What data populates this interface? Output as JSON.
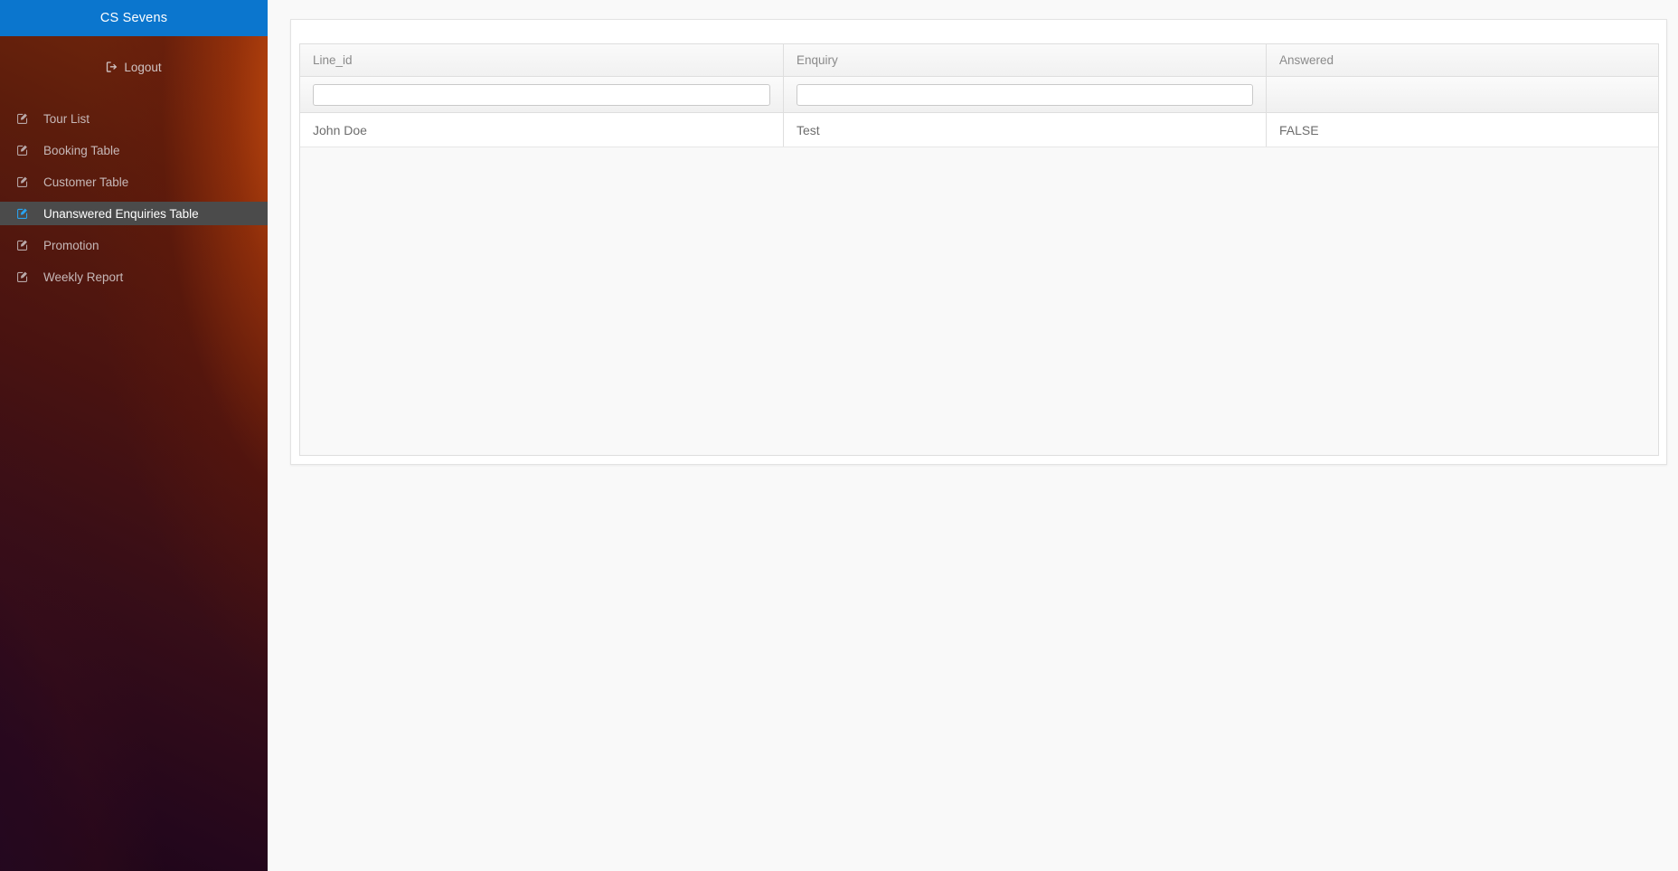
{
  "sidebar": {
    "brand": "CS Sevens",
    "logout": {
      "label": "Logout",
      "icon": "sign-out-icon"
    },
    "items": [
      {
        "label": "Tour List",
        "icon": "edit-square-icon",
        "active": false
      },
      {
        "label": "Booking Table",
        "icon": "edit-square-icon",
        "active": false
      },
      {
        "label": "Customer Table",
        "icon": "edit-square-icon",
        "active": false
      },
      {
        "label": "Unanswered Enquiries Table",
        "icon": "edit-square-icon",
        "active": true
      },
      {
        "label": "Promotion",
        "icon": "edit-square-icon",
        "active": false
      },
      {
        "label": "Weekly Report",
        "icon": "edit-square-icon",
        "active": false
      }
    ]
  },
  "table": {
    "columns": [
      {
        "header": "Line_id",
        "has_filter": true,
        "filter_value": "",
        "filter_placeholder": ""
      },
      {
        "header": "Enquiry",
        "has_filter": true,
        "filter_value": "",
        "filter_placeholder": ""
      },
      {
        "header": "Answered",
        "has_filter": false,
        "filter_value": "",
        "filter_placeholder": ""
      }
    ],
    "rows": [
      {
        "line_id": "John Doe",
        "enquiry": "Test",
        "answered": "FALSE"
      }
    ]
  },
  "colors": {
    "brand_blue": "#0b76ce",
    "active_item_bg": "#4b4b4b",
    "active_icon": "#2aa3f0",
    "page_bg": "#f9f9f9"
  }
}
